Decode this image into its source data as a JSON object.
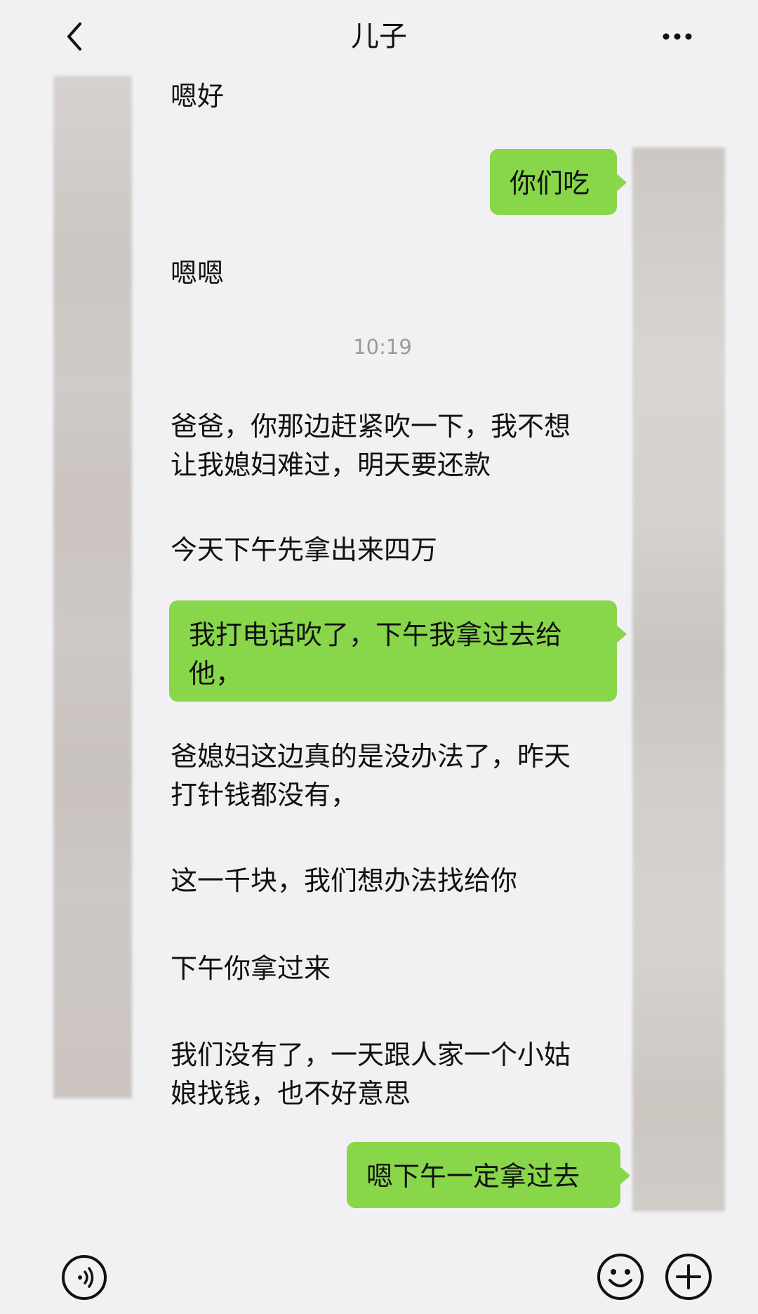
{
  "header": {
    "title": "儿子",
    "back_icon": "chevron-left-icon",
    "more_icon": "more-horizontal-icon"
  },
  "messages": [
    {
      "side": "left",
      "text": "嗯好"
    },
    {
      "side": "right",
      "text": "你们吃"
    },
    {
      "side": "left",
      "text": "嗯嗯"
    },
    {
      "side": "left",
      "text": "爸爸，你那边赶紧吹一下，我不想\n让我媳妇难过，明天要还款"
    },
    {
      "side": "left",
      "text": "今天下午先拿出来四万"
    },
    {
      "side": "right",
      "text": "我打电话吹了，下午我拿过去给\n他，"
    },
    {
      "side": "left",
      "text": "爸媳妇这边真的是没办法了，昨天\n打针钱都没有，"
    },
    {
      "side": "left",
      "text": "这一千块，我们想办法找给你"
    },
    {
      "side": "left",
      "text": "下午你拿过来"
    },
    {
      "side": "left",
      "text": "我们没有了，一天跟人家一个小姑\n娘找钱，也不好意思"
    },
    {
      "side": "right",
      "text": "嗯下午一定拿过去"
    }
  ],
  "timestamp": "10:19",
  "bottom_bar": {
    "voice_icon": "voice-input-icon",
    "emoji_icon": "emoji-icon",
    "plus_icon": "plus-circle-icon"
  },
  "colors": {
    "background": "#f1f1f3",
    "bubble_green": "#88d64a",
    "text": "#111111",
    "timestamp": "#9a9a9a"
  }
}
